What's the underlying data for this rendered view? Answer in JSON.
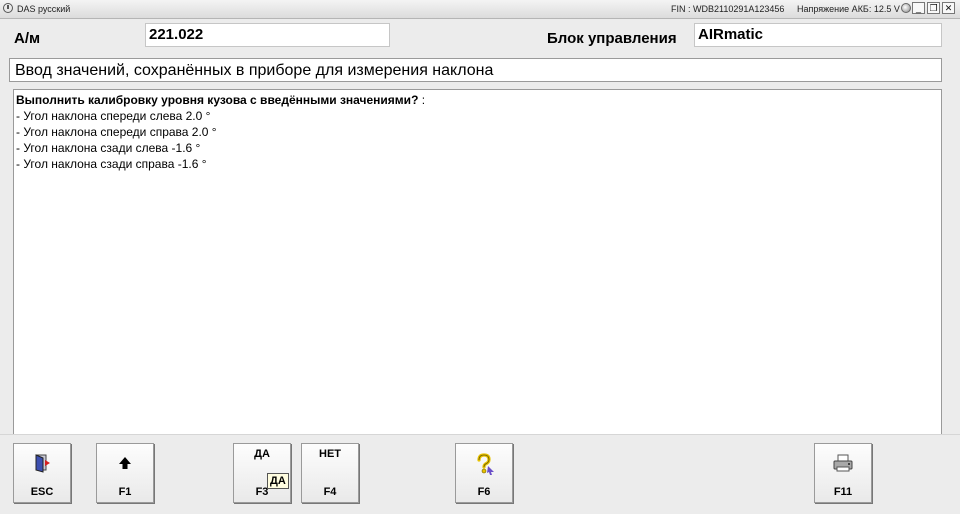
{
  "window": {
    "title": "DAS русский",
    "fin": "FIN : WDB2110291A123456",
    "voltage": "Напряжение АКБ: 12.5 V",
    "min_glyph": "_",
    "restore_glyph": "❐",
    "close_glyph": "✕"
  },
  "header": {
    "vehicle_label": "А/м",
    "vehicle_value": "221.022",
    "unit_label": "Блок управления",
    "unit_value": "AIRmatic"
  },
  "subtitle": "Ввод значений, сохранённых в приборе для измерения наклона",
  "content": {
    "question": "Выполнить калибровку уровня кузова с введёнными значениями?",
    "question_suffix": " :",
    "lines": [
      "- Угол наклона спереди слева  2.0 °",
      "- Угол наклона спереди справа  2.0 °",
      "- Угол наклона сзади слева  -1.6 °",
      "- Угол наклона сзади справа  -1.6 °"
    ]
  },
  "fkeys": {
    "esc": {
      "key": "ESC",
      "icon": "exit-door-icon"
    },
    "f1": {
      "key": "F1",
      "icon": "arrow-up-icon"
    },
    "f3": {
      "key": "F3",
      "caption": "ДА"
    },
    "f4": {
      "key": "F4",
      "caption": "НЕТ"
    },
    "f6": {
      "key": "F6",
      "icon": "help-question-icon"
    },
    "f11": {
      "key": "F11",
      "icon": "printer-icon"
    }
  },
  "tooltip": "ДА"
}
